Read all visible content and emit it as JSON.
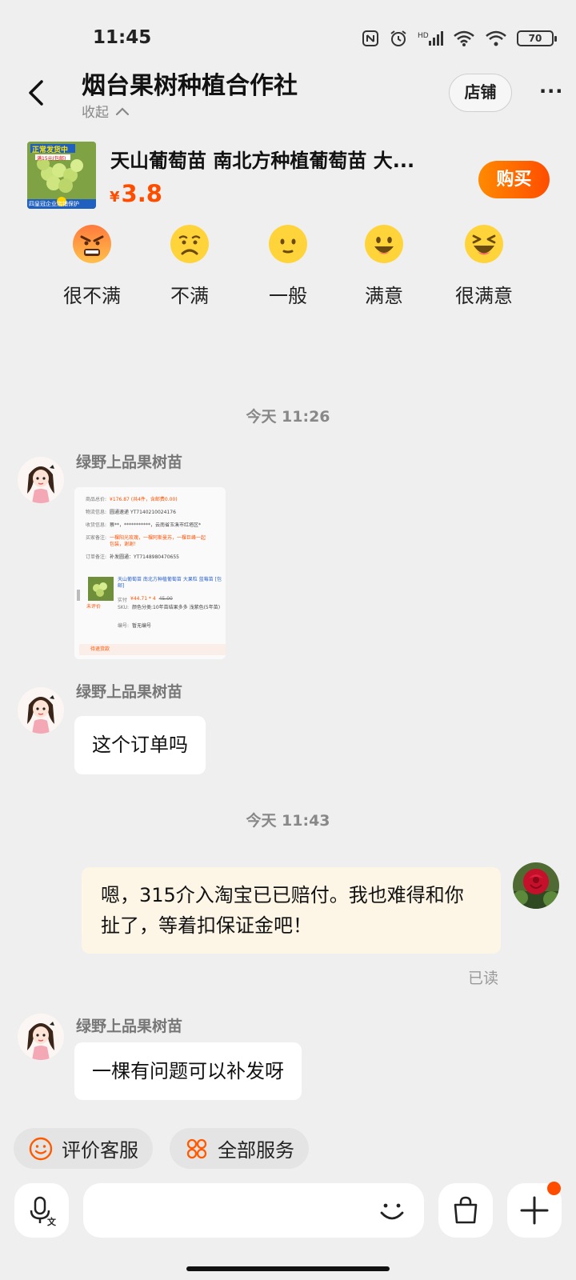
{
  "status_bar": {
    "time": "11:45",
    "battery": "70"
  },
  "header": {
    "shop_name": "烟台果树种植合作社",
    "collapse_label": "收起",
    "store_button": "店铺",
    "more": "···"
  },
  "product": {
    "title": "天山葡萄苗 南北方种植葡萄苗 大...",
    "price_symbol": "¥",
    "price": "3.8",
    "buy_button": "购买",
    "thumb_banner": "正常发货中",
    "thumb_note": "满15元(包邮)",
    "thumb_footer": "四皇冠企业店铺保护"
  },
  "ratings": [
    {
      "label": "很不满",
      "icon": "very-angry-emoji-icon"
    },
    {
      "label": "不满",
      "icon": "frown-emoji-icon"
    },
    {
      "label": "一般",
      "icon": "neutral-emoji-icon"
    },
    {
      "label": "满意",
      "icon": "smile-emoji-icon"
    },
    {
      "label": "很满意",
      "icon": "laughing-emoji-icon"
    }
  ],
  "chat": {
    "timestamp_1": "今天  11:26",
    "timestamp_2": "今天  11:43",
    "seller_name": "绿野上品果树苗",
    "order_image": {
      "rows": [
        {
          "k": "商品总价:",
          "v": "¥176.87 (共4件，含邮费0.00)"
        },
        {
          "k": "物流信息:",
          "v": "圆通速递 YT7140210024176"
        },
        {
          "k": "收货信息:",
          "v": "蔡**，***********，云南省玉溪市红塔区*"
        },
        {
          "k": "买家备注:",
          "v": "一棵阳光玫瑰，一棵阿斯曼苏，一棵巨峰一起包装，谢谢！"
        },
        {
          "k": "订单备注:",
          "v": "补发圆通：YT7148980470655"
        }
      ],
      "item_title": "天山葡萄苗 南北方种植葡萄苗 大果粒 蓝莓苗 [包邮]",
      "item_price_label": "实付",
      "item_price": "¥44.71 * 4",
      "item_price_old": "45.00",
      "sku_label": "SKU:",
      "sku_value": "颜色分类:10年苗结果多多 浅紫色(5年苗)",
      "code_label": "编号:",
      "code_value": "暂无编号",
      "unrated": "未评价",
      "footer": "待退货款"
    },
    "messages": [
      {
        "side": "left",
        "text": "这个订单吗"
      },
      {
        "side": "right",
        "text": "嗯，315介入淘宝已已赔付。我也难得和你扯了，等着扣保证金吧！"
      },
      {
        "side": "left",
        "text": "一棵有问题可以补发呀"
      }
    ],
    "read_status": "已读"
  },
  "quick_actions": [
    {
      "label": "评价客服",
      "icon": "smiley-circle-icon"
    },
    {
      "label": "全部服务",
      "icon": "services-grid-icon"
    }
  ],
  "input": {
    "placeholder": ""
  },
  "colors": {
    "accent": "#ff4d00",
    "background": "#efefef",
    "my_bubble": "#fdf5e6"
  }
}
